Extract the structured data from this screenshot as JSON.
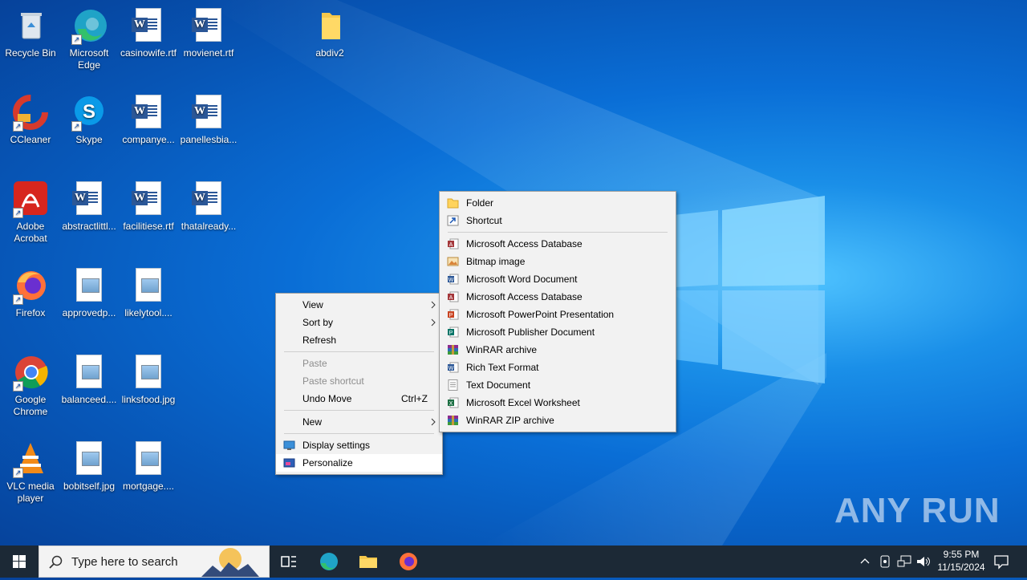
{
  "desktop": {
    "icons": [
      {
        "label": "Recycle Bin",
        "icon": "recycle-bin-icon"
      },
      {
        "label": "Microsoft Edge",
        "icon": "edge-icon"
      },
      {
        "label": "casinowife.rtf",
        "icon": "word-doc-icon"
      },
      {
        "label": "movienet.rtf",
        "icon": "word-doc-icon"
      },
      {
        "label": "abdiv2",
        "icon": "folder-icon"
      },
      {
        "label": "CCleaner",
        "icon": "ccleaner-icon"
      },
      {
        "label": "Skype",
        "icon": "skype-icon"
      },
      {
        "label": "companye...",
        "icon": "word-doc-icon"
      },
      {
        "label": "panellesbia...",
        "icon": "word-doc-icon"
      },
      {
        "label": "Adobe Acrobat",
        "icon": "acrobat-icon"
      },
      {
        "label": "abstractlittl...",
        "icon": "word-doc-icon"
      },
      {
        "label": "facilitiese.rtf",
        "icon": "word-doc-icon"
      },
      {
        "label": "thatalready...",
        "icon": "word-doc-icon"
      },
      {
        "label": "Firefox",
        "icon": "firefox-icon"
      },
      {
        "label": "approvedp...",
        "icon": "image-file-icon"
      },
      {
        "label": "likelytool....",
        "icon": "image-file-icon"
      },
      {
        "label": "Google Chrome",
        "icon": "chrome-icon"
      },
      {
        "label": "balanceed....",
        "icon": "image-file-icon"
      },
      {
        "label": "linksfood.jpg",
        "icon": "image-file-icon"
      },
      {
        "label": "VLC media player",
        "icon": "vlc-icon"
      },
      {
        "label": "bobitself.jpg",
        "icon": "image-file-icon"
      },
      {
        "label": "mortgage....",
        "icon": "image-file-icon"
      }
    ]
  },
  "context_menu": {
    "view": "View",
    "sort_by": "Sort by",
    "refresh": "Refresh",
    "paste": "Paste",
    "paste_shortcut": "Paste shortcut",
    "undo_move": "Undo Move",
    "undo_shortcut": "Ctrl+Z",
    "new": "New",
    "display_settings": "Display settings",
    "personalize": "Personalize"
  },
  "new_submenu": {
    "folder": "Folder",
    "shortcut": "Shortcut",
    "items": [
      {
        "label": "Microsoft Access Database",
        "icon": "access-icon"
      },
      {
        "label": "Bitmap image",
        "icon": "bitmap-icon"
      },
      {
        "label": "Microsoft Word Document",
        "icon": "word-icon"
      },
      {
        "label": "Microsoft Access Database",
        "icon": "access-icon"
      },
      {
        "label": "Microsoft PowerPoint Presentation",
        "icon": "powerpoint-icon"
      },
      {
        "label": "Microsoft Publisher Document",
        "icon": "publisher-icon"
      },
      {
        "label": "WinRAR archive",
        "icon": "winrar-icon"
      },
      {
        "label": "Rich Text Format",
        "icon": "word-icon"
      },
      {
        "label": "Text Document",
        "icon": "text-icon"
      },
      {
        "label": "Microsoft Excel Worksheet",
        "icon": "excel-icon"
      },
      {
        "label": "WinRAR ZIP archive",
        "icon": "winrar-icon"
      }
    ]
  },
  "taskbar": {
    "search_placeholder": "Type here to search",
    "time": "9:55 PM",
    "date": "11/15/2024"
  },
  "watermark": "ANY RUN",
  "colors": {
    "accent": "#0a6ed6",
    "taskbar": "#1c2936",
    "menu_bg": "#f2f2f2"
  }
}
